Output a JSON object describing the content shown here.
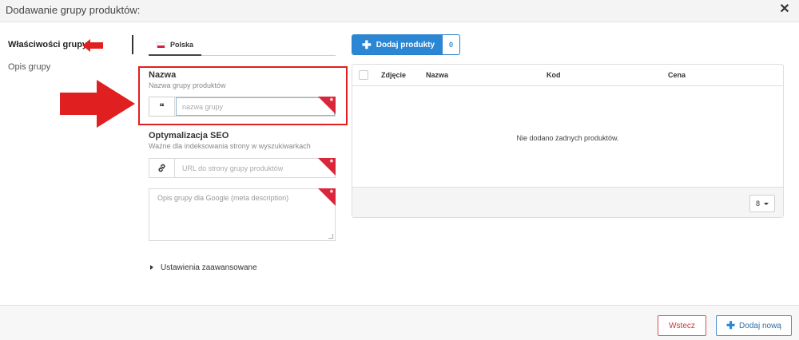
{
  "header": {
    "title": "Dodawanie grupy produktów:",
    "close_icon": "close-icon"
  },
  "nav": {
    "items": [
      {
        "label": "Właściwości grupy",
        "active": true
      },
      {
        "label": "Opis grupy",
        "active": false
      }
    ]
  },
  "language_tab": {
    "label": "Polska",
    "flag": "poland-flag"
  },
  "name_section": {
    "title": "Nazwa",
    "subtitle": "Nazwa grupy produktów",
    "placeholder": "nazwa grupy",
    "value": "",
    "addon_icon": "quote-icon",
    "required": true
  },
  "seo_section": {
    "title": "Optymalizacja SEO",
    "subtitle": "Ważne dla indeksowania strony w wyszukiwarkach",
    "url_placeholder": "URL do strony grupy produktów",
    "url_addon_icon": "link-icon",
    "description_placeholder": "Opis grupy dla Google (meta description)"
  },
  "advanced_settings": {
    "label": "Ustawienia zaawansowane"
  },
  "products": {
    "add_button_label": "Dodaj produkty",
    "count": "0",
    "columns": [
      "Zdjęcie",
      "Nazwa",
      "Kod",
      "Cena"
    ],
    "empty_message": "Nie dodano żadnych produktów.",
    "page_size": "8"
  },
  "footer": {
    "back_label": "Wstecz",
    "add_new_label": "Dodaj nową"
  },
  "colors": {
    "accent": "#2b86d4",
    "danger": "#d9263a",
    "annotation_red": "#e02020"
  }
}
